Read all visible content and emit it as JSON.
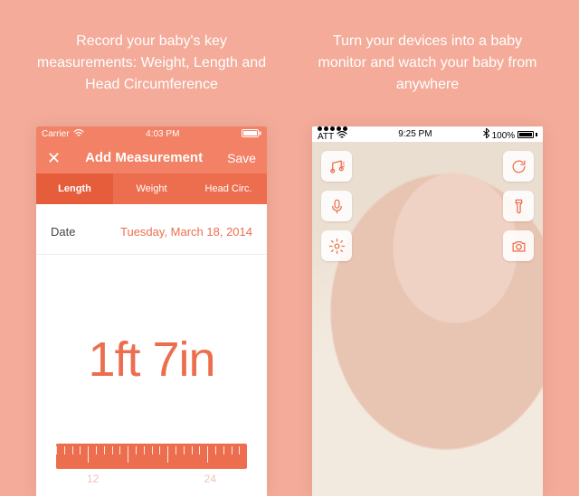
{
  "left": {
    "blurb": "Record your baby's key measurements: Weight, Length and Head Circumference",
    "statusbar": {
      "carrier": "Carrier",
      "time": "4:03 PM"
    },
    "nav": {
      "close_icon": "close-icon",
      "title": "Add Measurement",
      "save": "Save"
    },
    "tabs": {
      "length": "Length",
      "weight": "Weight",
      "head": "Head Circ."
    },
    "date": {
      "label": "Date",
      "value": "Tuesday, March 18, 2014"
    },
    "measurement": "1ft 7in",
    "ruler": {
      "label_a": "12",
      "label_b": "24"
    }
  },
  "right": {
    "blurb": "Turn your devices into a baby monitor and watch your baby from anywhere",
    "statusbar": {
      "carrier": "ATT",
      "time": "9:25 PM",
      "battery": "100%"
    },
    "tools": {
      "music": "music-icon",
      "mic": "mic-icon",
      "settings": "gear-icon",
      "refresh": "refresh-icon",
      "flash": "flashlight-icon",
      "camera": "camera-icon"
    }
  }
}
